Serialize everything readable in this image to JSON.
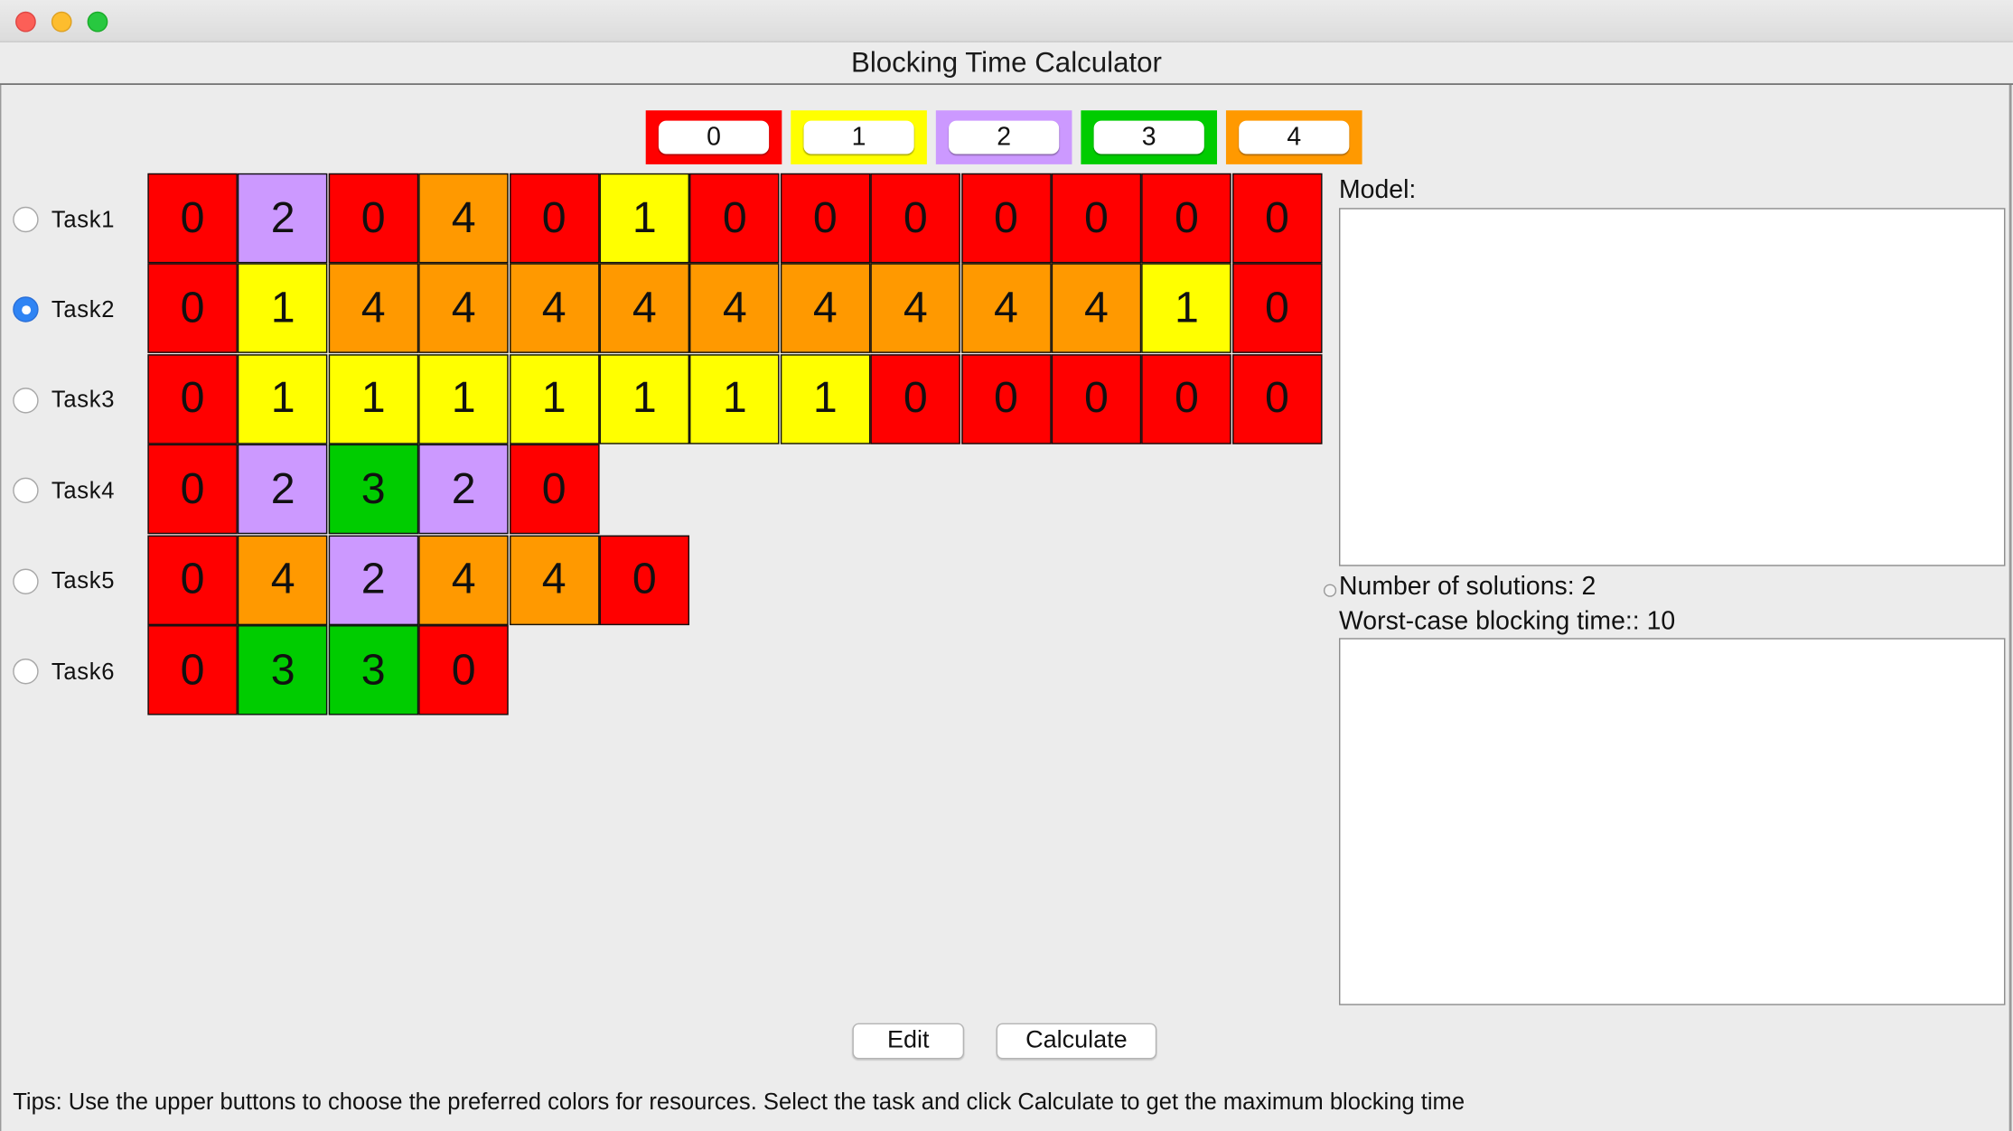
{
  "window": {
    "title": "Blocking Time Calculator"
  },
  "colors": {
    "0": "#ff0000",
    "1": "#ffff00",
    "2": "#cc99ff",
    "3": "#00cc00",
    "4": "#ff9900"
  },
  "color_buttons": [
    "0",
    "1",
    "2",
    "3",
    "4"
  ],
  "tasks": [
    {
      "label": "Task1",
      "selected": false,
      "cells": [
        0,
        2,
        0,
        4,
        0,
        1,
        0,
        0,
        0,
        0,
        0,
        0,
        0
      ]
    },
    {
      "label": "Task2",
      "selected": true,
      "cells": [
        0,
        1,
        4,
        4,
        4,
        4,
        4,
        4,
        4,
        4,
        4,
        1,
        0
      ]
    },
    {
      "label": "Task3",
      "selected": false,
      "cells": [
        0,
        1,
        1,
        1,
        1,
        1,
        1,
        1,
        0,
        0,
        0,
        0,
        0
      ]
    },
    {
      "label": "Task4",
      "selected": false,
      "cells": [
        0,
        2,
        3,
        2,
        0
      ]
    },
    {
      "label": "Task5",
      "selected": false,
      "cells": [
        0,
        4,
        2,
        4,
        4,
        0
      ]
    },
    {
      "label": "Task6",
      "selected": false,
      "cells": [
        0,
        3,
        3,
        0
      ]
    }
  ],
  "right_panel": {
    "model_label": "Model:",
    "solutions_text": "Number of solutions: 2",
    "blocking_text": "Worst-case blocking time:: 10"
  },
  "buttons": {
    "edit": "Edit",
    "calculate": "Calculate"
  },
  "tips": "Tips: Use the upper buttons to choose the preferred colors for resources. Select the task and click Calculate to get the maximum blocking time"
}
